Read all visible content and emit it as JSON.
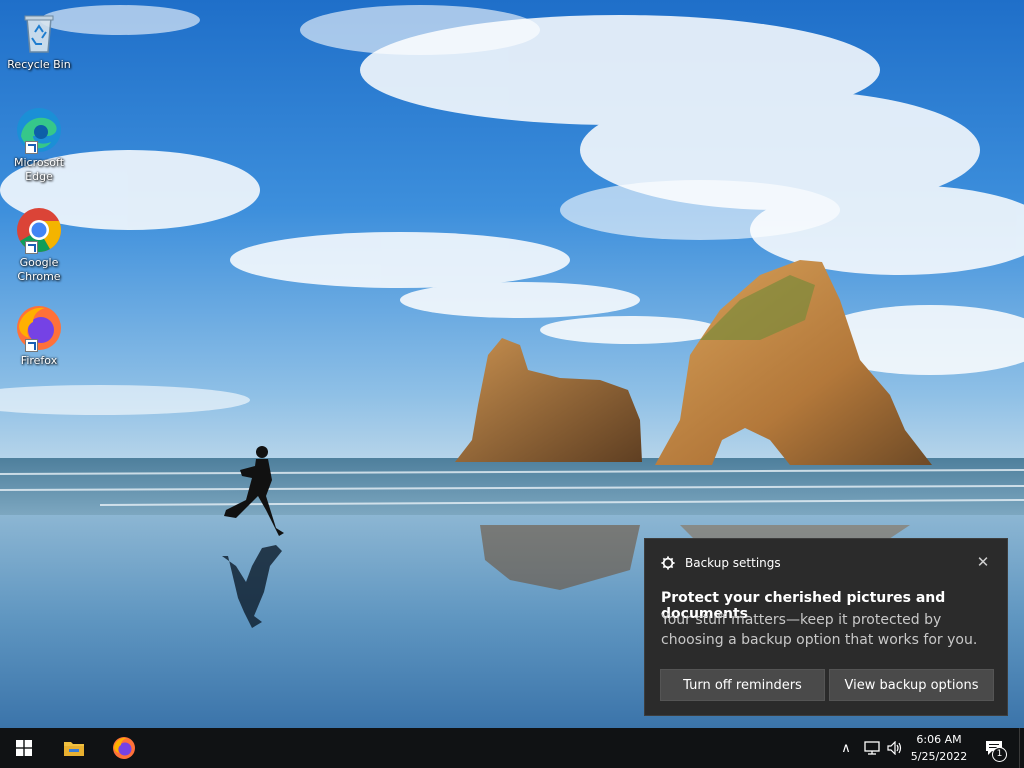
{
  "desktop": {
    "icons": [
      {
        "label": "Recycle Bin"
      },
      {
        "label": "Microsoft Edge"
      },
      {
        "label": "Google Chrome"
      },
      {
        "label": "Firefox"
      }
    ]
  },
  "toast": {
    "app_name": "Backup settings",
    "title": "Protect your cherished pictures and documents",
    "body": "Your stuff matters—keep it protected by choosing a backup option that works for you.",
    "button_1": "Turn off reminders",
    "button_2": "View backup options",
    "close_glyph": "✕"
  },
  "taskbar": {
    "time": "6:06 AM",
    "date": "5/25/2022",
    "notification_count": "1",
    "tray_chevron": "∧"
  },
  "colors": {
    "taskbar": "#101214",
    "toast_bg": "#2b2b2b",
    "toast_button": "#4a4a4a"
  }
}
